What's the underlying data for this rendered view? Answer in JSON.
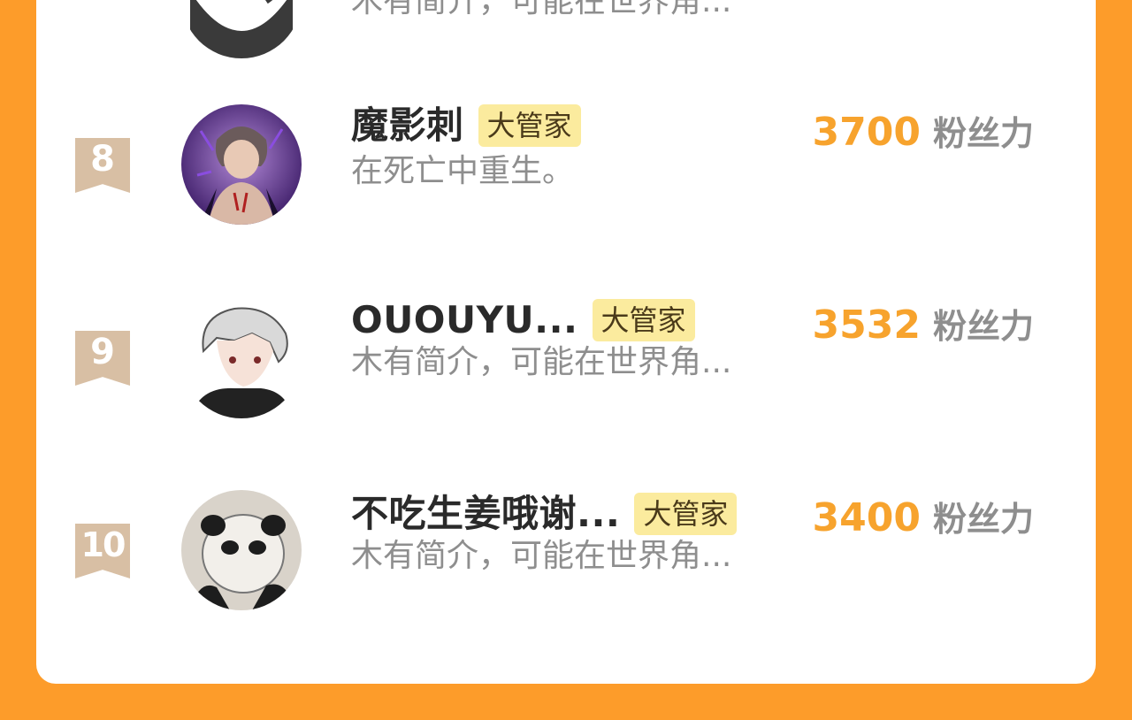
{
  "rows": [
    {
      "rank": "",
      "name": "",
      "badge": "",
      "bio": "木有简介，可能在世界角...",
      "score": "",
      "unit": ""
    },
    {
      "rank": "8",
      "name": "魔影刺",
      "badge": "大管家",
      "bio": "在死亡中重生。",
      "score": "3700",
      "unit": "粉丝力"
    },
    {
      "rank": "9",
      "name": "OUOUYU...",
      "badge": "大管家",
      "bio": "木有简介，可能在世界角...",
      "score": "3532",
      "unit": "粉丝力"
    },
    {
      "rank": "10",
      "name": "不吃生姜哦谢...",
      "badge": "大管家",
      "bio": "木有简介，可能在世界角...",
      "score": "3400",
      "unit": "粉丝力"
    }
  ],
  "colors": {
    "background": "#FD9C2A",
    "score": "#F7A32D",
    "badge": "#FBEB9E",
    "rank_ribbon": "#D8BFA4"
  }
}
